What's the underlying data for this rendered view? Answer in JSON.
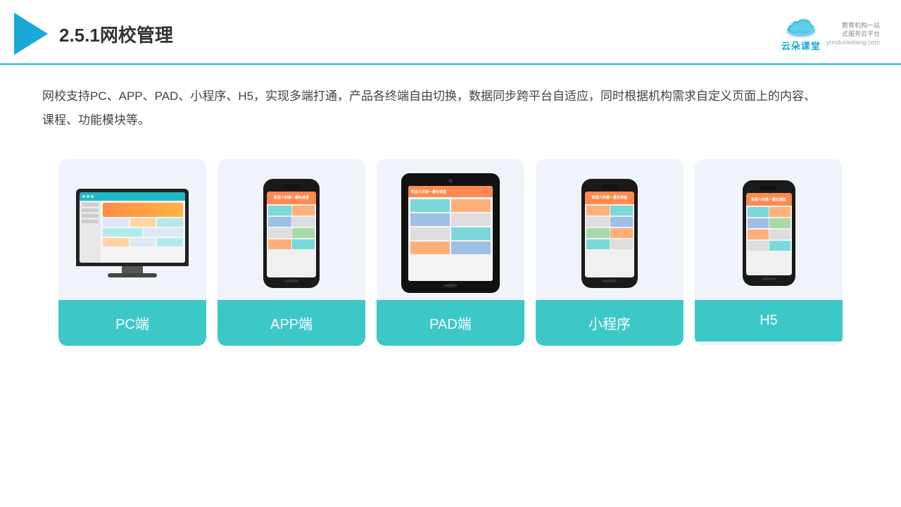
{
  "header": {
    "title": "2.5.1网校管理",
    "brand": {
      "name": "云朵课堂",
      "url": "yunduoketang.com",
      "tagline": "教育机构一站\n式服务云平台"
    }
  },
  "description": "网校支持PC、APP、PAD、小程序、H5，实现多端打通，产品各终端自由切换，数据同步跨平台自适应，同时根据机构需求自定义页面上的内容、课程、功能模块等。",
  "cards": [
    {
      "label": "PC端",
      "type": "pc"
    },
    {
      "label": "APP端",
      "type": "phone"
    },
    {
      "label": "PAD端",
      "type": "tablet"
    },
    {
      "label": "小程序",
      "type": "phone"
    },
    {
      "label": "H5",
      "type": "phone"
    }
  ],
  "colors": {
    "accent": "#1fb8c3",
    "card_bg": "#f0f4fa",
    "card_label_bg": "#3dc8c8",
    "header_border": "#1fb8c3"
  }
}
